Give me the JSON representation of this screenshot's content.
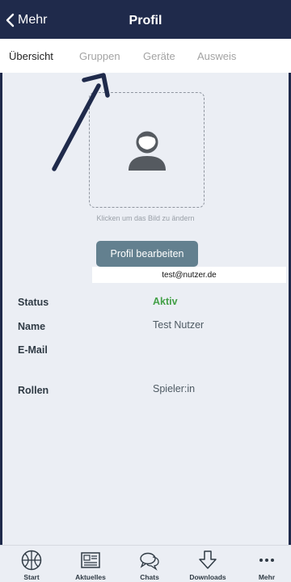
{
  "header": {
    "back_label": "Mehr",
    "title": "Profil"
  },
  "tabs": [
    {
      "label": "Übersicht",
      "active": true
    },
    {
      "label": "Gruppen",
      "active": false
    },
    {
      "label": "Geräte",
      "active": false
    },
    {
      "label": "Ausweis",
      "active": false
    }
  ],
  "profile": {
    "avatar_hint": "Klicken um das Bild zu ändern",
    "edit_label": "Profil bearbeiten",
    "fields": {
      "status_label": "Status",
      "status_value": "Aktiv",
      "name_label": "Name",
      "name_value": "Test Nutzer",
      "email_label": "E-Mail",
      "email_value": "test@nutzer.de",
      "roles_label": "Rollen",
      "roles_value": "Spieler:in"
    }
  },
  "nav": [
    {
      "label": "Start",
      "icon": "basketball-icon"
    },
    {
      "label": "Aktuelles",
      "icon": "newspaper-icon"
    },
    {
      "label": "Chats",
      "icon": "chat-bubbles-icon"
    },
    {
      "label": "Downloads",
      "icon": "download-icon"
    },
    {
      "label": "Mehr",
      "icon": "more-dots-icon"
    }
  ],
  "colors": {
    "header_bg": "#1f2a4b",
    "accent_button": "#63808f",
    "status_active": "#43a047"
  }
}
